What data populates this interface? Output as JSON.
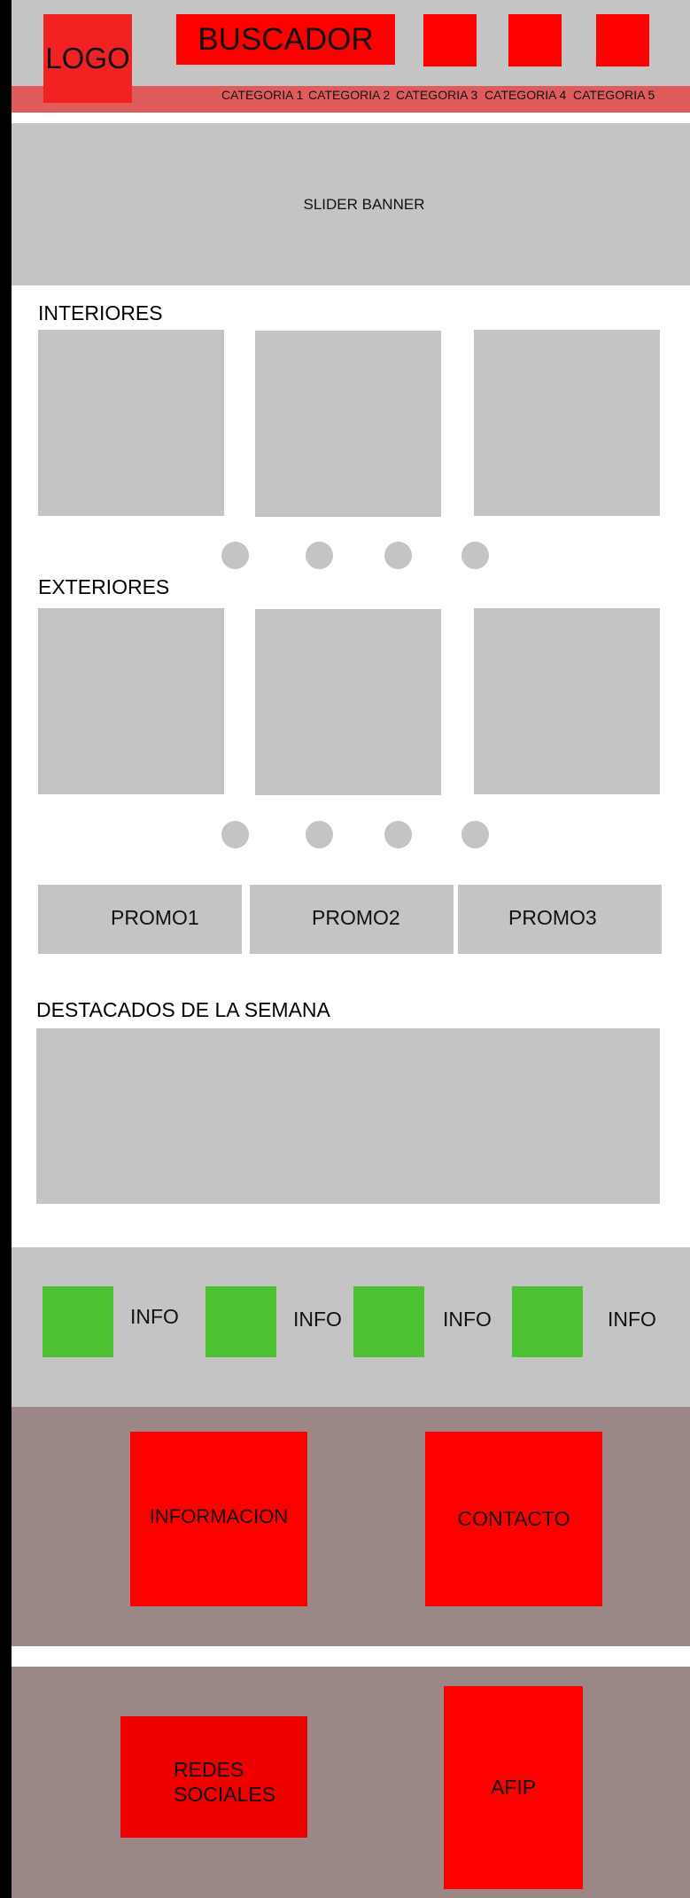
{
  "header": {
    "logo": "LOGO",
    "search": "BUSCADOR",
    "icons": [
      "",
      "",
      ""
    ],
    "categories": [
      "CATEGORIA 1",
      "CATEGORIA 2",
      "CATEGORIA 3",
      "CATEGORIA 4",
      "CATEGORIA 5"
    ]
  },
  "banner": {
    "label": "SLIDER BANNER"
  },
  "interiores": {
    "title": "INTERIORES"
  },
  "exteriores": {
    "title": "EXTERIORES"
  },
  "promos": [
    "PROMO1",
    "PROMO2",
    "PROMO3"
  ],
  "destacados": {
    "title": "DESTACADOS DE LA SEMANA"
  },
  "info_strip": {
    "labels": [
      "INFO",
      "INFO",
      "INFO",
      "INFO"
    ]
  },
  "footer": {
    "informacion": "INFORMACION",
    "contacto": "CONTACTO",
    "redes_line1": "REDES",
    "redes_line2": "SOCIALES",
    "afip": "AFIP"
  },
  "colors": {
    "red": "#ff0000",
    "category_bar": "#e05c5c",
    "gray": "#c4c4c4",
    "green": "#4cc233",
    "footer_brown": "#9b8786"
  }
}
